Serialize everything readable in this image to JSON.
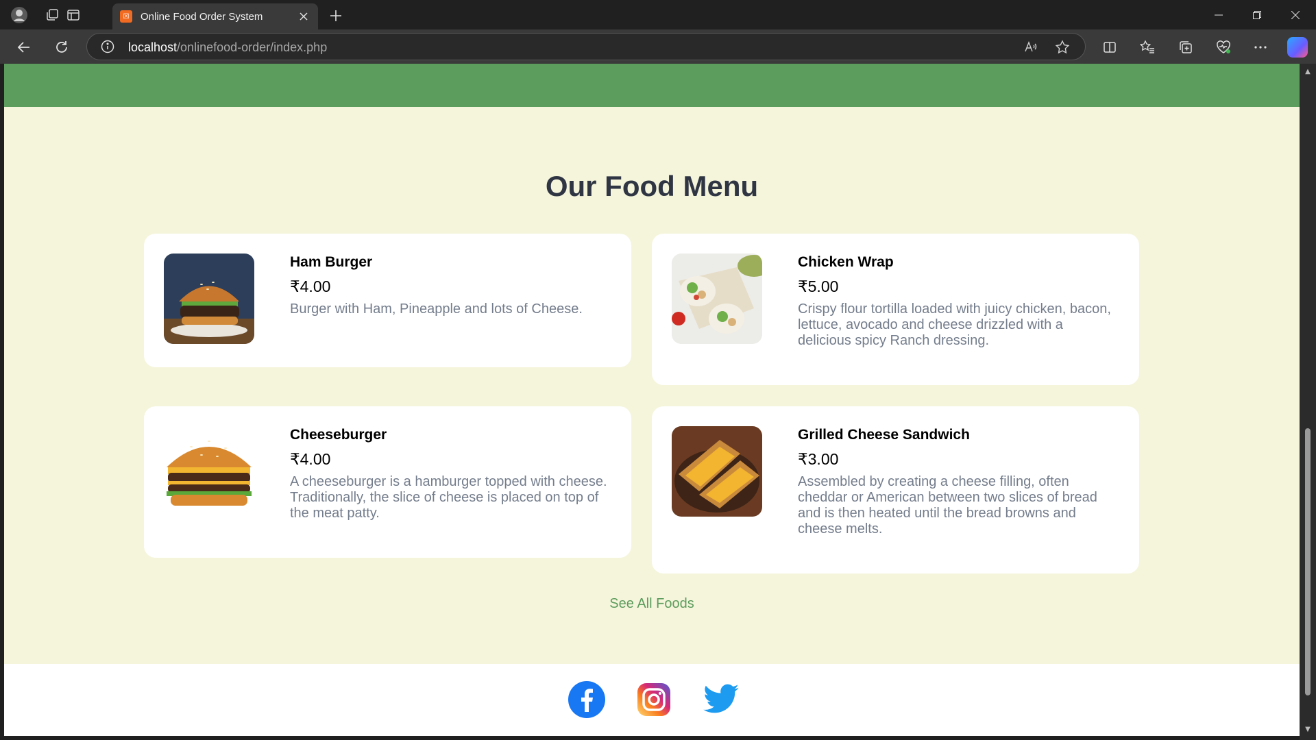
{
  "browser": {
    "tab_title": "Online Food Order System",
    "url_host": "localhost",
    "url_path": "/onlinefood-order/index.php"
  },
  "page": {
    "section_title": "Our Food Menu",
    "see_all": "See All Foods",
    "foods": [
      {
        "name": "Ham Burger",
        "price": "₹4.00",
        "description": "Burger with Ham, Pineapple and lots of Cheese."
      },
      {
        "name": "Chicken Wrap",
        "price": "₹5.00",
        "description": "Crispy flour tortilla loaded with juicy chicken, bacon, lettuce, avocado and cheese drizzled with a delicious spicy Ranch dressing."
      },
      {
        "name": "Cheeseburger",
        "price": "₹4.00",
        "description": "A cheeseburger is a hamburger topped with cheese. Traditionally, the slice of cheese is placed on top of the meat patty."
      },
      {
        "name": "Grilled Cheese Sandwich",
        "price": "₹3.00",
        "description": "Assembled by creating a cheese filling, often cheddar or American between two slices of bread and is then heated until the bread browns and cheese melts."
      }
    ],
    "social": [
      "facebook-icon",
      "instagram-icon",
      "twitter-icon"
    ]
  },
  "colors": {
    "header_green": "#5c9c5c",
    "page_background": "#f5f5dc",
    "title_text": "#2f3542",
    "description_text": "#747d8c"
  }
}
